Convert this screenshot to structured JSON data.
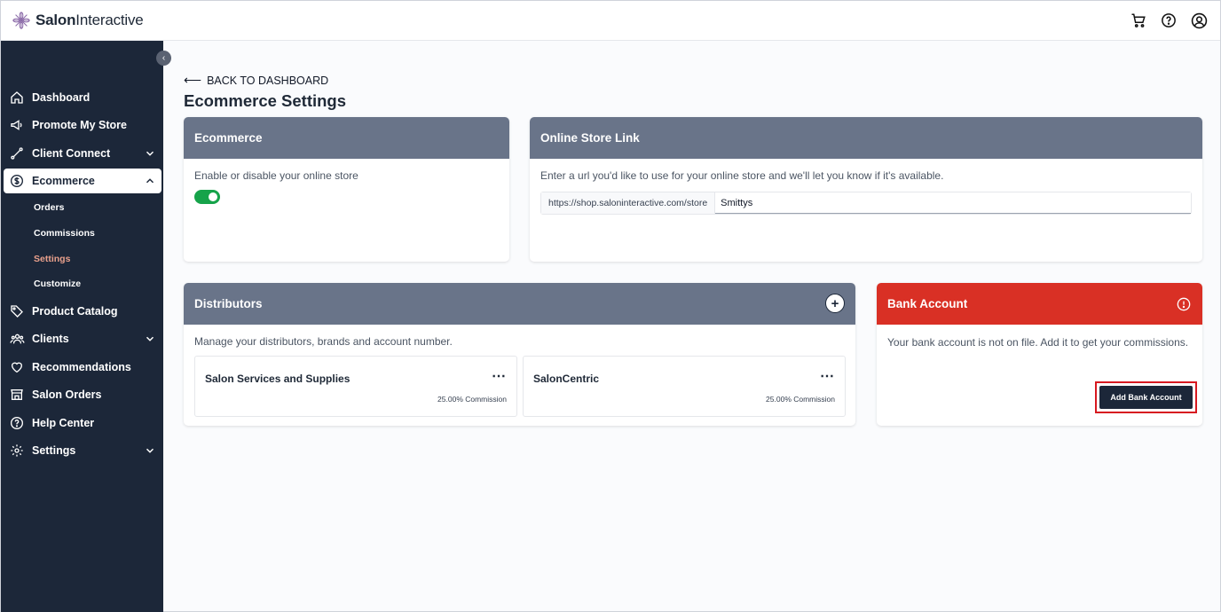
{
  "header": {
    "brand_bold": "Salon",
    "brand_rest": "Interactive",
    "icons": [
      "cart-icon",
      "help-icon",
      "user-icon"
    ]
  },
  "sidebar": {
    "items": [
      {
        "label": "Dashboard",
        "icon": "home-icon"
      },
      {
        "label": "Promote My Store",
        "icon": "megaphone-icon"
      },
      {
        "label": "Client Connect",
        "icon": "connect-icon"
      },
      {
        "label": "Ecommerce",
        "icon": "dollar-icon"
      },
      {
        "label": "Product Catalog",
        "icon": "tag-icon"
      },
      {
        "label": "Clients",
        "icon": "users-icon"
      },
      {
        "label": "Recommendations",
        "icon": "heart-icon"
      },
      {
        "label": "Salon Orders",
        "icon": "store-icon"
      },
      {
        "label": "Help Center",
        "icon": "help-icon"
      },
      {
        "label": "Settings",
        "icon": "gear-icon"
      }
    ],
    "ecommerce_sub": [
      "Orders",
      "Commissions",
      "Settings",
      "Customize"
    ]
  },
  "main": {
    "back_label": "BACK TO DASHBOARD",
    "title": "Ecommerce Settings",
    "ecommerce_card": {
      "title": "Ecommerce",
      "description": "Enable or disable your online store",
      "enabled": true
    },
    "store_link_card": {
      "title": "Online Store Link",
      "description": "Enter a url you'd like to use for your online store and we'll let you know if it's available.",
      "url_prefix": "https://shop.saloninteractive.com/store",
      "url_value": "Smittys"
    },
    "distributors_card": {
      "title": "Distributors",
      "description": "Manage your distributors, brands and account number.",
      "items": [
        {
          "name": "Salon Services and Supplies",
          "commission": "25.00% Commission"
        },
        {
          "name": "SalonCentric",
          "commission": "25.00% Commission"
        }
      ]
    },
    "bank_card": {
      "title": "Bank Account",
      "message": "Your bank account is not on file. Add it to get your commissions.",
      "button_label": "Add Bank Account",
      "accent": "#d93025"
    }
  }
}
